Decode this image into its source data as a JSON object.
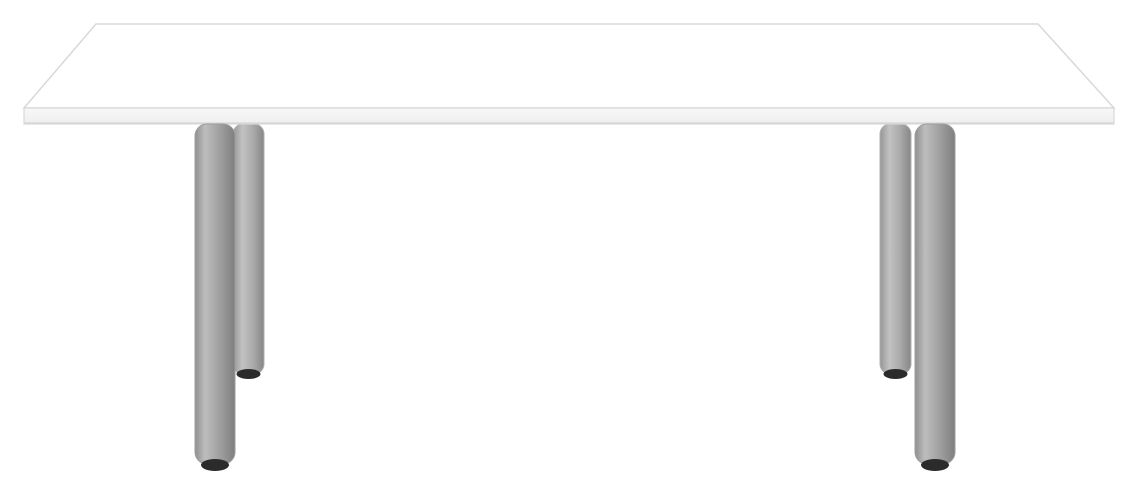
{
  "image": {
    "subject": "table",
    "colors": {
      "background": "#ffffff",
      "tabletop_top": "#ffffff",
      "tabletop_edge": "#f3f3f3",
      "outline": "#d8d8d8",
      "leg_light": "#b8b8b8",
      "leg_mid": "#9c9c9c",
      "leg_dark": "#7a7a7a",
      "foot": "#2b2b2b"
    }
  }
}
